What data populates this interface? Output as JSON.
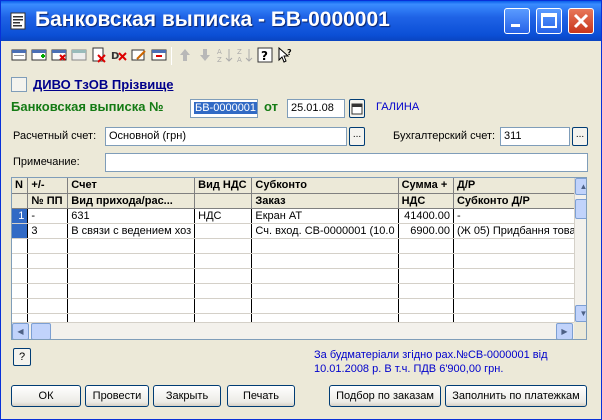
{
  "window": {
    "title": "Банковская выписка - БВ-0000001"
  },
  "link": "ДИВО ТзОВ Прізвище",
  "doc": {
    "header_label": "Банковская выписка №",
    "number": "БВ-0000001",
    "date_label": "от",
    "date": "25.01.08",
    "user": "ГАЛИНА",
    "account_label": "Расчетный счет:",
    "account_value": "Основной (грн)",
    "book_account_label": "Бухгалтерский счет:",
    "book_account_value": "311",
    "note_label": "Примечание:",
    "note_value": ""
  },
  "table": {
    "header1": [
      "N",
      "+/-",
      "Счет",
      "Вид НДС",
      "Субконто",
      "Сумма +",
      "Д/Р"
    ],
    "header2": [
      "",
      "№ ПП",
      "Вид прихода/рас...",
      "",
      "Заказ",
      "НДС",
      "Субконто Д/Р"
    ],
    "rows": [
      {
        "n": "1",
        "pm": "-",
        "schet": "631",
        "vid_nds": "НДС",
        "subkonto": "Екран АТ",
        "summa": "41400.00",
        "dr": "-"
      },
      {
        "n": "",
        "pm": "3",
        "schet": "В связи с ведением хоз",
        "vid_nds": "",
        "subkonto": "Сч. вход. СВ-0000001 (10.0",
        "summa": "6900.00",
        "dr": "(Ж 05) Придбання товар"
      }
    ]
  },
  "footer_note": "За будматеріали згідно рах.№СВ-0000001 від 10.01.2008 р. В т.ч. ПДВ 6'900,00 грн.",
  "buttons": {
    "help": "?",
    "ok": "ОК",
    "post": "Провести",
    "close": "Закрыть",
    "print": "Печать",
    "orders": "Подбор по заказам",
    "payments": "Заполнить по платежкам"
  },
  "colors": {
    "titlebar": "#0B4FD6",
    "green": "#147B14",
    "blue_text": "#0000CC",
    "selection": "#316AC5"
  }
}
